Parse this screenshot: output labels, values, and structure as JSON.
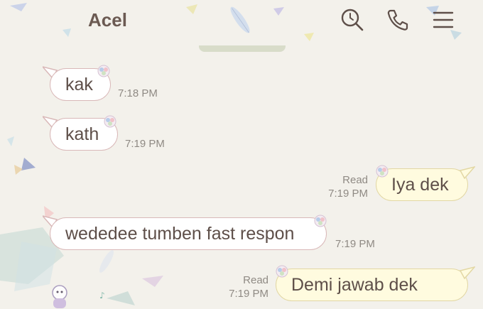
{
  "header": {
    "title": "Acel",
    "icons": [
      "search-icon",
      "phone-icon",
      "menu-icon"
    ]
  },
  "messages": [
    {
      "side": "in",
      "text": "kak",
      "time": "7:18 PM"
    },
    {
      "side": "in",
      "text": "kath",
      "time": "7:19 PM"
    },
    {
      "side": "out",
      "text": "Iya dek",
      "read": "Read",
      "time": "7:19 PM"
    },
    {
      "side": "in",
      "text": "wededee tumben fast respon",
      "time": "7:19 PM"
    },
    {
      "side": "out",
      "text": "Demi jawab dek",
      "read": "Read",
      "time": "7:19 PM"
    }
  ],
  "colors": {
    "background": "#f3f1eb",
    "incoming_bubble": "#ffffff",
    "outgoing_bubble": "#fffbdf",
    "title": "#6b5a52",
    "meta": "#8f8a84"
  }
}
